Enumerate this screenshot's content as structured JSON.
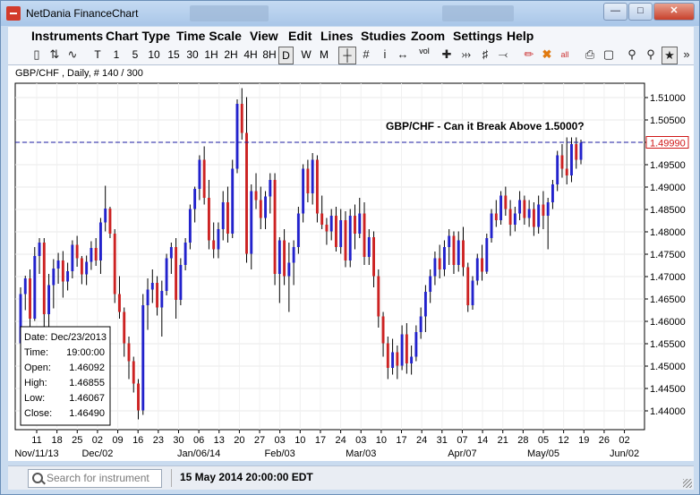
{
  "window": {
    "title": "NetDania FinanceChart"
  },
  "menu": [
    "Instruments",
    "Chart Type",
    "Time Scale",
    "View",
    "Edit",
    "Lines",
    "Studies",
    "Zoom",
    "Settings",
    "Help"
  ],
  "toolbar": {
    "timescale_buttons": [
      "T",
      "1",
      "5",
      "10",
      "15",
      "30",
      "1H",
      "2H",
      "4H",
      "8H",
      "D",
      "W",
      "M"
    ],
    "selected_timescale": "D",
    "vol_label": "vol",
    "all_label": "all"
  },
  "chart": {
    "header": "GBP/CHF , Daily, # 140 / 300",
    "annotation": "GBP/CHF - Can it Break Above 1.5000?",
    "current_price": "1.49990",
    "infobox": {
      "rows": [
        {
          "label": "Date:",
          "value": "Dec/23/2013"
        },
        {
          "label": "Time:",
          "value": "19:00:00"
        },
        {
          "label": "Open:",
          "value": "1.46092"
        },
        {
          "label": "High:",
          "value": "1.46855"
        },
        {
          "label": "Low:",
          "value": "1.46067"
        },
        {
          "label": "Close:",
          "value": "1.46490"
        }
      ]
    }
  },
  "chart_data": {
    "type": "candlestick",
    "title": "",
    "ylim": [
      1.4375,
      1.5135
    ],
    "y_ticks": [
      "1.51000",
      "1.50500",
      "1.50000",
      "1.49500",
      "1.49000",
      "1.48500",
      "1.48000",
      "1.47500",
      "1.47000",
      "1.46500",
      "1.46000",
      "1.45500",
      "1.45000",
      "1.44500",
      "1.44000"
    ],
    "x_tick_days": [
      "11",
      "18",
      "25",
      "02",
      "09",
      "16",
      "23",
      "30",
      "06",
      "13",
      "20",
      "27",
      "03",
      "10",
      "17",
      "24",
      "03",
      "10",
      "17",
      "24",
      "31",
      "07",
      "14",
      "21",
      "28",
      "05",
      "12",
      "19",
      "26",
      "02"
    ],
    "x_tick_months": [
      "Nov/11/13",
      "Dec/02",
      "Jan/06/14",
      "Feb/03",
      "Mar/03",
      "Apr/07",
      "May/05",
      "Jun/02"
    ],
    "reference_line": 1.5,
    "bull_color": "#2222cc",
    "bear_color": "#cc2222",
    "candles": [
      [
        1.4551,
        1.4676,
        1.4541,
        1.4661
      ],
      [
        1.4661,
        1.4702,
        1.4625,
        1.4696
      ],
      [
        1.4696,
        1.4716,
        1.4582,
        1.4606
      ],
      [
        1.4606,
        1.4766,
        1.4601,
        1.4746
      ],
      [
        1.4746,
        1.4786,
        1.4706,
        1.4776
      ],
      [
        1.4776,
        1.4786,
        1.4586,
        1.4616
      ],
      [
        1.4616,
        1.4706,
        1.4561,
        1.4681
      ],
      [
        1.4681,
        1.4739,
        1.4629,
        1.4718
      ],
      [
        1.4718,
        1.4753,
        1.4684,
        1.4736
      ],
      [
        1.4736,
        1.4757,
        1.4653,
        1.4689
      ],
      [
        1.4689,
        1.4731,
        1.4669,
        1.4712
      ],
      [
        1.4712,
        1.4781,
        1.4696,
        1.4771
      ],
      [
        1.4771,
        1.4791,
        1.4722,
        1.4741
      ],
      [
        1.4741,
        1.4746,
        1.4683,
        1.4705
      ],
      [
        1.4705,
        1.4747,
        1.4681,
        1.4733
      ],
      [
        1.4733,
        1.4779,
        1.4715,
        1.4764
      ],
      [
        1.4764,
        1.4786,
        1.4724,
        1.4736
      ],
      [
        1.4736,
        1.4831,
        1.4706,
        1.4821
      ],
      [
        1.4821,
        1.4903,
        1.4801,
        1.4852
      ],
      [
        1.4852,
        1.4856,
        1.4786,
        1.4796
      ],
      [
        1.4796,
        1.4806,
        1.4641,
        1.4661
      ],
      [
        1.4661,
        1.4701,
        1.4606,
        1.4621
      ],
      [
        1.4621,
        1.4631,
        1.4521,
        1.4551
      ],
      [
        1.4551,
        1.4566,
        1.4471,
        1.4511
      ],
      [
        1.4511,
        1.4521,
        1.4441,
        1.4461
      ],
      [
        1.4461,
        1.4471,
        1.4381,
        1.4401
      ],
      [
        1.4401,
        1.4661,
        1.4391,
        1.4636
      ],
      [
        1.4636,
        1.4696,
        1.4581,
        1.4671
      ],
      [
        1.4671,
        1.4716,
        1.4641,
        1.4686
      ],
      [
        1.4686,
        1.4701,
        1.4613,
        1.4631
      ],
      [
        1.4631,
        1.4691,
        1.4566,
        1.4668
      ],
      [
        1.4668,
        1.4751,
        1.4658,
        1.4741
      ],
      [
        1.4741,
        1.4776,
        1.4706,
        1.4766
      ],
      [
        1.4766,
        1.4786,
        1.4606,
        1.4648
      ],
      [
        1.4648,
        1.4741,
        1.4636,
        1.4726
      ],
      [
        1.4726,
        1.4786,
        1.4714,
        1.4776
      ],
      [
        1.4776,
        1.4861,
        1.4761,
        1.4851
      ],
      [
        1.4851,
        1.4901,
        1.4821,
        1.4896
      ],
      [
        1.4896,
        1.4971,
        1.4871,
        1.4961
      ],
      [
        1.4961,
        1.4991,
        1.4861,
        1.4876
      ],
      [
        1.4876,
        1.4916,
        1.4761,
        1.4781
      ],
      [
        1.4781,
        1.4821,
        1.4741,
        1.4761
      ],
      [
        1.4761,
        1.4821,
        1.4741,
        1.4806
      ],
      [
        1.4806,
        1.4891,
        1.4781,
        1.4866
      ],
      [
        1.4866,
        1.4901,
        1.4776,
        1.4796
      ],
      [
        1.4796,
        1.4961,
        1.4786,
        1.4941
      ],
      [
        1.4941,
        1.5096,
        1.4931,
        1.5086
      ],
      [
        1.5086,
        1.5121,
        1.5006,
        1.5021
      ],
      [
        1.5021,
        1.5101,
        1.4731,
        1.4751
      ],
      [
        1.4751,
        1.4906,
        1.4716,
        1.4891
      ],
      [
        1.4891,
        1.4931,
        1.4851,
        1.4871
      ],
      [
        1.4871,
        1.4901,
        1.4806,
        1.4831
      ],
      [
        1.4831,
        1.4891,
        1.4806,
        1.4879
      ],
      [
        1.4879,
        1.4931,
        1.4841,
        1.4916
      ],
      [
        1.4916,
        1.4931,
        1.4681,
        1.4706
      ],
      [
        1.4706,
        1.4788,
        1.4641,
        1.4781
      ],
      [
        1.4781,
        1.4806,
        1.4681,
        1.4701
      ],
      [
        1.4701,
        1.4776,
        1.4621,
        1.4731
      ],
      [
        1.4731,
        1.4781,
        1.4681,
        1.4766
      ],
      [
        1.4766,
        1.4856,
        1.4751,
        1.4841
      ],
      [
        1.4841,
        1.4951,
        1.4821,
        1.4941
      ],
      [
        1.4941,
        1.4961,
        1.4866,
        1.4886
      ],
      [
        1.4886,
        1.4976,
        1.4861,
        1.4961
      ],
      [
        1.4961,
        1.4971,
        1.4821,
        1.4841
      ],
      [
        1.4841,
        1.4881,
        1.4806,
        1.4816
      ],
      [
        1.4816,
        1.4831,
        1.4771,
        1.4801
      ],
      [
        1.4801,
        1.4851,
        1.4781,
        1.4836
      ],
      [
        1.4836,
        1.4856,
        1.4756,
        1.4766
      ],
      [
        1.4766,
        1.4851,
        1.4751,
        1.4826
      ],
      [
        1.4826,
        1.4846,
        1.4721,
        1.4736
      ],
      [
        1.4736,
        1.4851,
        1.4721,
        1.4836
      ],
      [
        1.4836,
        1.4861,
        1.4761,
        1.4796
      ],
      [
        1.4796,
        1.4876,
        1.4786,
        1.4841
      ],
      [
        1.4841,
        1.4866,
        1.4726,
        1.4744
      ],
      [
        1.4744,
        1.4806,
        1.4726,
        1.4788
      ],
      [
        1.4788,
        1.4801,
        1.4676,
        1.4701
      ],
      [
        1.4701,
        1.4716,
        1.4586,
        1.4611
      ],
      [
        1.4611,
        1.4621,
        1.4521,
        1.4551
      ],
      [
        1.4551,
        1.4566,
        1.4471,
        1.4496
      ],
      [
        1.4496,
        1.4561,
        1.4481,
        1.4531
      ],
      [
        1.4531,
        1.4546,
        1.4471,
        1.4501
      ],
      [
        1.4501,
        1.4591,
        1.4491,
        1.4571
      ],
      [
        1.4571,
        1.4596,
        1.4483,
        1.4506
      ],
      [
        1.4506,
        1.4546,
        1.4481,
        1.4521
      ],
      [
        1.4521,
        1.4591,
        1.4511,
        1.4576
      ],
      [
        1.4576,
        1.4631,
        1.4561,
        1.4611
      ],
      [
        1.4611,
        1.4681,
        1.4576,
        1.4666
      ],
      [
        1.4666,
        1.4716,
        1.4641,
        1.4701
      ],
      [
        1.4701,
        1.4756,
        1.4681,
        1.4741
      ],
      [
        1.4741,
        1.4771,
        1.4696,
        1.4716
      ],
      [
        1.4716,
        1.4781,
        1.4701,
        1.4766
      ],
      [
        1.4766,
        1.4806,
        1.4726,
        1.4791
      ],
      [
        1.4791,
        1.4801,
        1.4706,
        1.4726
      ],
      [
        1.4726,
        1.4801,
        1.4711,
        1.4781
      ],
      [
        1.4781,
        1.4811,
        1.4701,
        1.4721
      ],
      [
        1.4721,
        1.4731,
        1.4621,
        1.4636
      ],
      [
        1.4636,
        1.4701,
        1.4626,
        1.4691
      ],
      [
        1.4691,
        1.4751,
        1.4681,
        1.4741
      ],
      [
        1.4741,
        1.4771,
        1.4691,
        1.4711
      ],
      [
        1.4711,
        1.4796,
        1.4706,
        1.4786
      ],
      [
        1.4786,
        1.4851,
        1.4776,
        1.4841
      ],
      [
        1.4841,
        1.4871,
        1.4811,
        1.4826
      ],
      [
        1.4826,
        1.4891,
        1.4816,
        1.4881
      ],
      [
        1.4881,
        1.4901,
        1.4836,
        1.4851
      ],
      [
        1.4851,
        1.4871,
        1.4791,
        1.4816
      ],
      [
        1.4816,
        1.4856,
        1.4801,
        1.4841
      ],
      [
        1.4841,
        1.4891,
        1.4826,
        1.4871
      ],
      [
        1.4871,
        1.4881,
        1.4816,
        1.4831
      ],
      [
        1.4831,
        1.4871,
        1.4811,
        1.4851
      ],
      [
        1.4851,
        1.4866,
        1.4791,
        1.4811
      ],
      [
        1.4811,
        1.4881,
        1.4796,
        1.4861
      ],
      [
        1.4861,
        1.4891,
        1.4806,
        1.4836
      ],
      [
        1.4836,
        1.4876,
        1.4761,
        1.4866
      ],
      [
        1.4866,
        1.4916,
        1.4851,
        1.4906
      ],
      [
        1.4906,
        1.4981,
        1.4891,
        1.4971
      ],
      [
        1.4971,
        1.4996,
        1.4921,
        1.4941
      ],
      [
        1.4941,
        1.5011,
        1.4906,
        1.4926
      ],
      [
        1.4926,
        1.5011,
        1.4911,
        1.4996
      ],
      [
        1.4996,
        1.5011,
        1.4941,
        1.4961
      ],
      [
        1.4961,
        1.5006,
        1.4951,
        1.4999
      ]
    ]
  }
}
